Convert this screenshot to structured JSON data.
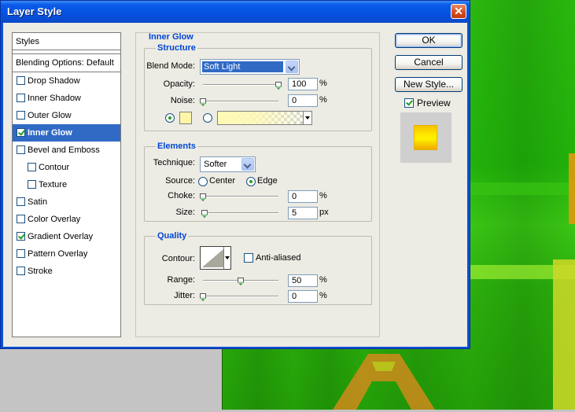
{
  "window": {
    "title": "Layer Style"
  },
  "styles_list": {
    "header": "Styles",
    "blending": "Blending Options: Default",
    "items": [
      {
        "label": "Drop Shadow",
        "checked": false,
        "selected": false,
        "sub": false
      },
      {
        "label": "Inner Shadow",
        "checked": false,
        "selected": false,
        "sub": false
      },
      {
        "label": "Outer Glow",
        "checked": false,
        "selected": false,
        "sub": false
      },
      {
        "label": "Inner Glow",
        "checked": true,
        "selected": true,
        "sub": false
      },
      {
        "label": "Bevel and Emboss",
        "checked": false,
        "selected": false,
        "sub": false
      },
      {
        "label": "Contour",
        "checked": false,
        "selected": false,
        "sub": true
      },
      {
        "label": "Texture",
        "checked": false,
        "selected": false,
        "sub": true
      },
      {
        "label": "Satin",
        "checked": false,
        "selected": false,
        "sub": false
      },
      {
        "label": "Color Overlay",
        "checked": false,
        "selected": false,
        "sub": false
      },
      {
        "label": "Gradient Overlay",
        "checked": true,
        "selected": false,
        "sub": false
      },
      {
        "label": "Pattern Overlay",
        "checked": false,
        "selected": false,
        "sub": false
      },
      {
        "label": "Stroke",
        "checked": false,
        "selected": false,
        "sub": false
      }
    ]
  },
  "panel": {
    "title": "Inner Glow",
    "structure": {
      "title": "Structure",
      "blend_mode_label": "Blend Mode:",
      "blend_mode_value": "Soft Light",
      "opacity_label": "Opacity:",
      "opacity_value": "100",
      "opacity_unit": "%",
      "opacity_fraction": 1.0,
      "noise_label": "Noise:",
      "noise_value": "0",
      "noise_unit": "%",
      "noise_fraction": 0.0,
      "glow_color": "#fff5a8",
      "fill_mode": "color"
    },
    "elements": {
      "title": "Elements",
      "technique_label": "Technique:",
      "technique_value": "Softer",
      "source_label": "Source:",
      "source_center": "Center",
      "source_edge": "Edge",
      "source_selected": "edge",
      "choke_label": "Choke:",
      "choke_value": "0",
      "choke_unit": "%",
      "choke_fraction": 0.0,
      "size_label": "Size:",
      "size_value": "5",
      "size_unit": "px",
      "size_fraction": 0.02
    },
    "quality": {
      "title": "Quality",
      "contour_label": "Contour:",
      "antialiased_label": "Anti-aliased",
      "antialiased": false,
      "range_label": "Range:",
      "range_value": "50",
      "range_unit": "%",
      "range_fraction": 0.5,
      "jitter_label": "Jitter:",
      "jitter_value": "0",
      "jitter_unit": "%",
      "jitter_fraction": 0.0
    }
  },
  "buttons": {
    "ok": "OK",
    "cancel": "Cancel",
    "new_style": "New Style...",
    "preview_label": "Preview",
    "preview_checked": true
  },
  "colors": {
    "title_bar": "#0551e0",
    "selection": "#316ac5",
    "section_title": "#0046d5",
    "canvas_green": "#22b20a"
  }
}
